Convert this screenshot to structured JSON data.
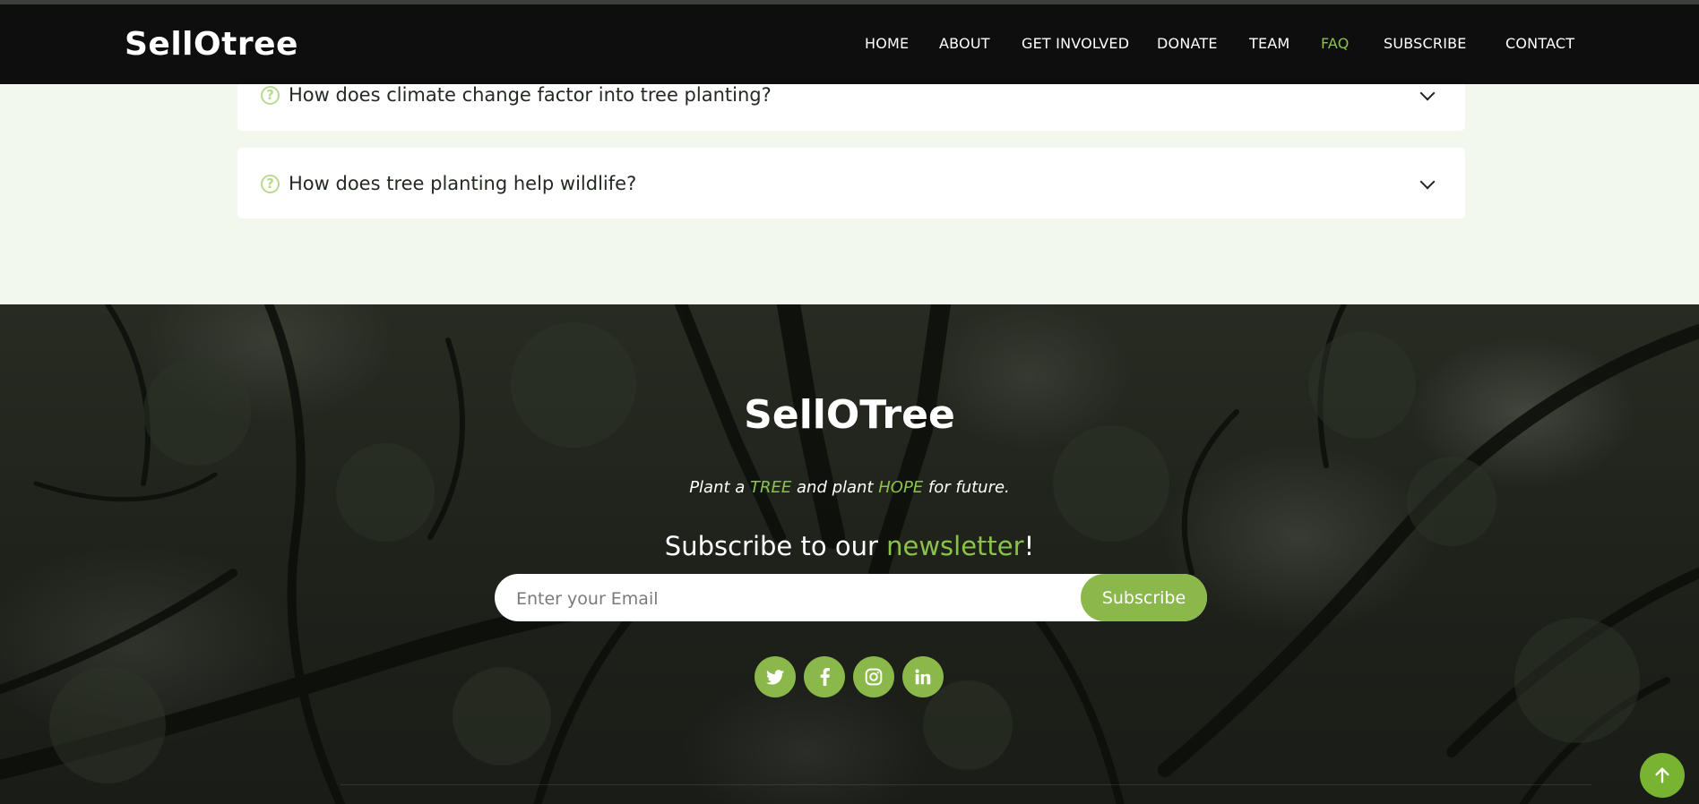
{
  "header": {
    "logo": "SellOtree",
    "nav": [
      {
        "label": "HOME",
        "active": false
      },
      {
        "label": "ABOUT",
        "active": false
      },
      {
        "label": "GET INVOLVED",
        "active": false
      },
      {
        "label": "DONATE",
        "active": false
      },
      {
        "label": "TEAM",
        "active": false
      },
      {
        "label": "FAQ",
        "active": true
      },
      {
        "label": "SUBSCRIBE",
        "active": false
      },
      {
        "label": "CONTACT",
        "active": false
      }
    ]
  },
  "faq": {
    "items": [
      {
        "question": "How does climate change factor into tree planting?",
        "icon": "question-circle-icon"
      },
      {
        "question": "How does tree planting help wildlife?",
        "icon": "question-circle-icon"
      }
    ]
  },
  "footer": {
    "brand": "SellOTree",
    "tagline": {
      "part1": "Plant a ",
      "highlight1": "TREE",
      "part2": " and plant ",
      "highlight2": "HOPE",
      "part3": " for future."
    },
    "subscribe_heading": {
      "part1": "Subscribe to our ",
      "highlight": "newsletter",
      "part2": "!"
    },
    "email_placeholder": "Enter your Email",
    "subscribe_button": "Subscribe",
    "socials": [
      "twitter-icon",
      "facebook-icon",
      "instagram-icon",
      "linkedin-icon"
    ]
  },
  "back_to_top_icon": "arrow-up-icon",
  "colors": {
    "accent": "#8ac24a",
    "header_bg": "#0e0e0e",
    "faq_bg": "#f2f8ee"
  }
}
